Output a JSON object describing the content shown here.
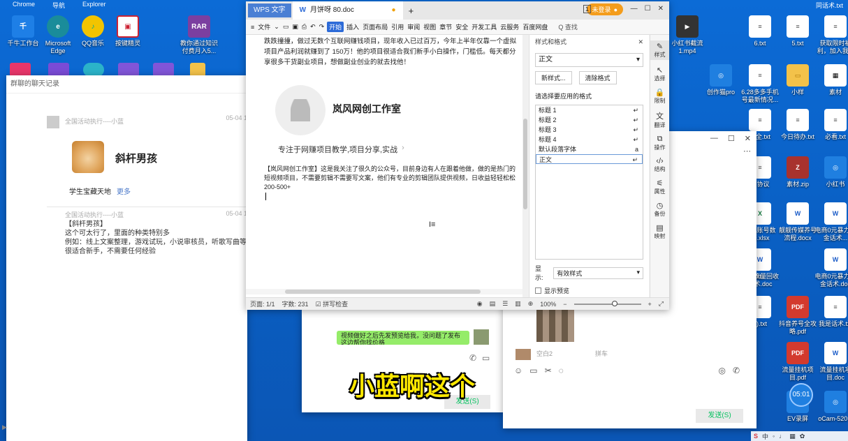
{
  "desktop": {
    "top_labels": [
      "Chrome",
      "导航",
      "Explorer"
    ],
    "top_right_label": "同话术.txt",
    "left_icons": [
      {
        "label": "千牛工作台",
        "color": "#1e7fe6"
      },
      {
        "label": "Microsoft Edge",
        "color": "#1a8c9a"
      },
      {
        "label": "QQ音乐",
        "color": "#f2c400"
      },
      {
        "label": "按键精灵",
        "color": "#c23"
      },
      {
        "label": "RAR",
        "color": "#7b3fa0"
      }
    ],
    "rar_label": "教你通过知识付费月入5...",
    "right_icons": [
      {
        "label": "小红书截流1.mp4",
        "kind": "video"
      },
      {
        "label": "6.txt",
        "kind": "txt"
      },
      {
        "label": "5.txt",
        "kind": "txt"
      },
      {
        "label": "获取限时福利，加入我...",
        "kind": "txt"
      },
      {
        "label": "创作猫pro",
        "kind": "app"
      },
      {
        "label": "6.28多多手机号最新情况...",
        "kind": "txt"
      },
      {
        "label": "小样",
        "kind": "folder"
      },
      {
        "label": "素材",
        "kind": "qr"
      },
      {
        "label": "今日待办.txt",
        "kind": "txt"
      },
      {
        "label": "必看.txt",
        "kind": "txt"
      },
      {
        "label": "大全.txt",
        "kind": "txt"
      },
      {
        "label": "素材.zip",
        "kind": "zip"
      },
      {
        "label": "小红书",
        "kind": "app"
      },
      {
        "label": "各协议",
        "kind": "txt"
      },
      {
        "label": "靓靓传媒养号流程.docx",
        "kind": "word"
      },
      {
        "label": "电商0元暴力撸金话术...",
        "kind": "word"
      },
      {
        "label": "手机账号数据.xlsx",
        "kind": "excel"
      },
      {
        "label": "挂机流量回收话术.doc",
        "kind": "word"
      },
      {
        "label": "电商0元暴力撸金话术.doc",
        "kind": "word"
      },
      {
        "label": "如套话术.txt",
        "kind": "txt"
      },
      {
        "label": "抖音养号全攻略.pdf",
        "kind": "pdf"
      },
      {
        "label": "我是话术.txt",
        "kind": "txt"
      },
      {
        "label": "2).txt",
        "kind": "txt"
      },
      {
        "label": "流量挂机项目.pdf",
        "kind": "pdf"
      },
      {
        "label": "流量挂机项目.doc",
        "kind": "word"
      },
      {
        "label": "EV录屏",
        "kind": "app"
      },
      {
        "label": "oCam-520...",
        "kind": "app"
      }
    ],
    "clock": "05:01"
  },
  "chat_history": {
    "title": "群聊的聊天记录",
    "msg1": {
      "sender": "全国活动执行----小蓝",
      "time": "05-04 1",
      "card_name": "斜杆男孩",
      "card_sub": "学生宝藏天地",
      "card_more": "更多"
    },
    "msg2": {
      "sender": "全国活动执行----小蓝",
      "time": "05-04 1",
      "lines": [
        "【斜杆男孩】",
        "这个可太行了，里面的种类特别多",
        "例如：线上文案整理，游戏试玩，小说审核员，听歌写曲等",
        "很适合新手，不需要任何经验"
      ]
    }
  },
  "wps": {
    "app_tab": "WPS 文字",
    "doc_tab": "月饼呀 80.doc",
    "new_tab": "+",
    "login_label": "未登录",
    "menu": [
      "文件",
      "开始",
      "插入",
      "页面布局",
      "引用",
      "审阅",
      "视图",
      "章节",
      "安全",
      "开发工具",
      "云服务",
      "百度网盘"
    ],
    "active_menu": "开始",
    "search_label": "Q 查找",
    "body_top": "跌跌撞撞，做过无数个互联网赚钱项目，现年收入已过百万，今年上半年仅靠一个虚拟项目产品利润就赚到了 150万！他的项目很适合我们新手小白操作，门槛低。每天都分享很多干货副业项目，想做副业创业的就去找他！",
    "profile_name": "岚风网创工作室",
    "profile_desc": "专注于网赚项目教学,项目分享,实战",
    "para": "【岚风网创工作室】这是我关注了很久的公众号，目前身边有人在跟着他做，做的是热门的短视频项目，不需要剪辑不需要写文案，他们有专业的剪辑团队提供视频，日收益轻轻松松200-500+",
    "status": {
      "page": "页面: 1/1",
      "words": "字数: 231",
      "spell": "拼写检查",
      "zoom": "100%"
    },
    "styles_pane": {
      "title": "样式和格式",
      "current": "正文",
      "new_btn": "新样式...",
      "clear_btn": "清除格式",
      "apply_label": "请选择要应用的格式",
      "styles": [
        "标题 1",
        "标题 2",
        "标题 3",
        "标题 4",
        "默认段落字体",
        "正文"
      ],
      "show_label": "显示:",
      "show_value": "有效样式",
      "preview_label": "显示预览"
    },
    "rail": [
      "样式",
      "选择",
      "限制",
      "翻译",
      "操作",
      "结构",
      "属性",
      "备份",
      "映射"
    ]
  },
  "wechat_right": {
    "name": "空白2",
    "tag": "拼车",
    "send": "发送(S)"
  },
  "wechat_left": {
    "bubble": "视频做好之后先发预览给我，没问题了发布这边帮你找价格",
    "send": "发送(S)"
  },
  "subtitle": "小蓝啊这个"
}
